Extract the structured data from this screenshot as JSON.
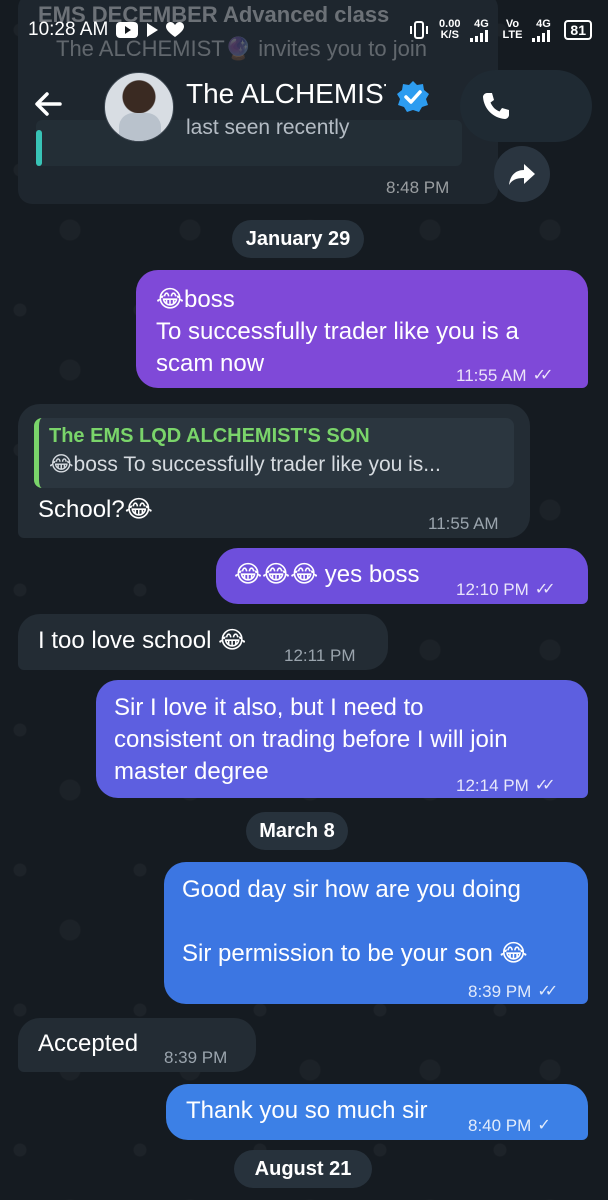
{
  "status_bar": {
    "time": "10:28 AM",
    "net_speed": "0.00",
    "net_unit": "K/S",
    "net1_top": "4G",
    "vo_top": "Vo",
    "vo_bottom": "LTE",
    "net2_top": "4G",
    "battery": "81"
  },
  "pinned_ghost": {
    "title": "EMS DECEMBER Advanced class",
    "subtitle": "The ALCHEMIST🔮 invites you to join",
    "time": "8:48 PM"
  },
  "header": {
    "name": "The ALCHEMIST",
    "status": "last seen recently"
  },
  "dates": {
    "d1": "January 29",
    "d2": "March 8",
    "d3": "August 21"
  },
  "messages": {
    "m1": {
      "line1": "😂boss",
      "line2": "To successfully trader like you is a",
      "line3": "scam now",
      "time": "11:55 AM"
    },
    "m2": {
      "quote_name": "The EMS LQD ALCHEMIST'S SON",
      "quote_text": "😂boss  To successfully trader like you is...",
      "text": "School?😂",
      "time": "11:55 AM"
    },
    "m3": {
      "text": "😂😂😂 yes boss",
      "time": "12:10 PM"
    },
    "m4": {
      "text": "I too love school 😂",
      "time": "12:11 PM"
    },
    "m5": {
      "line1": "Sir I love it also, but I need to",
      "line2": "consistent on trading before I will join",
      "line3": "master degree",
      "time": "12:14 PM"
    },
    "m6": {
      "line1": "Good day sir how are you doing",
      "line2": "Sir permission to be your son 😂",
      "time": "8:39 PM"
    },
    "m7": {
      "text": "Accepted",
      "time": "8:39 PM"
    },
    "m8": {
      "text": "Thank you so much sir",
      "time": "8:40 PM"
    }
  },
  "colors": {
    "purple_bubble": "#7f49d8",
    "indigo_bubble": "#5d5fe0",
    "blue_bubble": "#3c76e2",
    "incoming_bubble": "#232c34",
    "quote_accent": "#7ad46a"
  }
}
